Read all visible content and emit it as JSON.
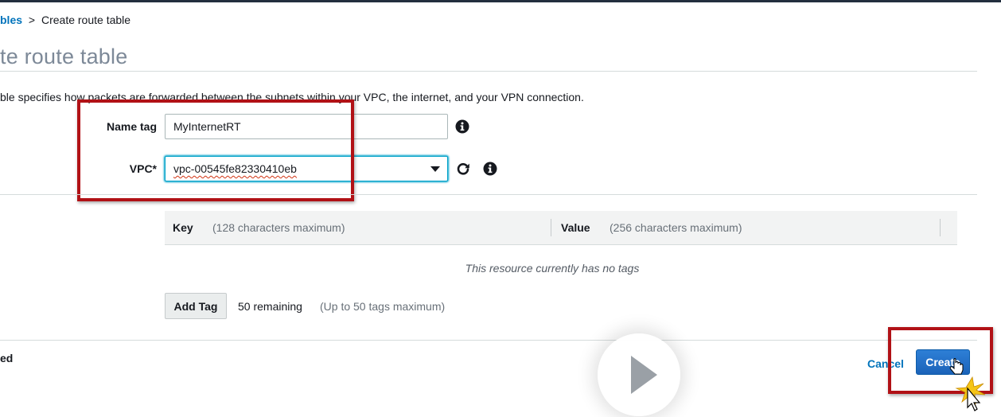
{
  "breadcrumb": {
    "parent_label": "bles",
    "separator": ">",
    "current_label": "Create route table"
  },
  "page": {
    "title": "te route table",
    "description": "ble specifies how packets are forwarded between the subnets within your VPC, the internet, and your VPN connection."
  },
  "form": {
    "name_tag": {
      "label": "Name tag",
      "value": "MyInternetRT"
    },
    "vpc": {
      "label": "VPC*",
      "value": "vpc-00545fe82330410eb"
    }
  },
  "tags": {
    "key_header": "Key",
    "key_hint": "(128 characters maximum)",
    "value_header": "Value",
    "value_hint": "(256 characters maximum)",
    "empty_message": "This resource currently has no tags",
    "add_tag_label": "Add Tag",
    "remaining": "50 remaining",
    "max_hint": "(Up to 50 tags maximum)"
  },
  "footer": {
    "required_note": "ed",
    "cancel_label": "Cancel",
    "create_label": "Create"
  },
  "icons": {
    "info": "info-icon",
    "refresh": "refresh-icon",
    "dropdown": "chevron-down-icon",
    "play": "play-icon",
    "cursor": "hand-cursor-icon",
    "click": "click-burst-icon"
  },
  "colors": {
    "link": "#0073bb",
    "primary": "#1b63b9",
    "highlight": "#b11116",
    "focus": "#00a1c9",
    "title": "#7d8998"
  }
}
